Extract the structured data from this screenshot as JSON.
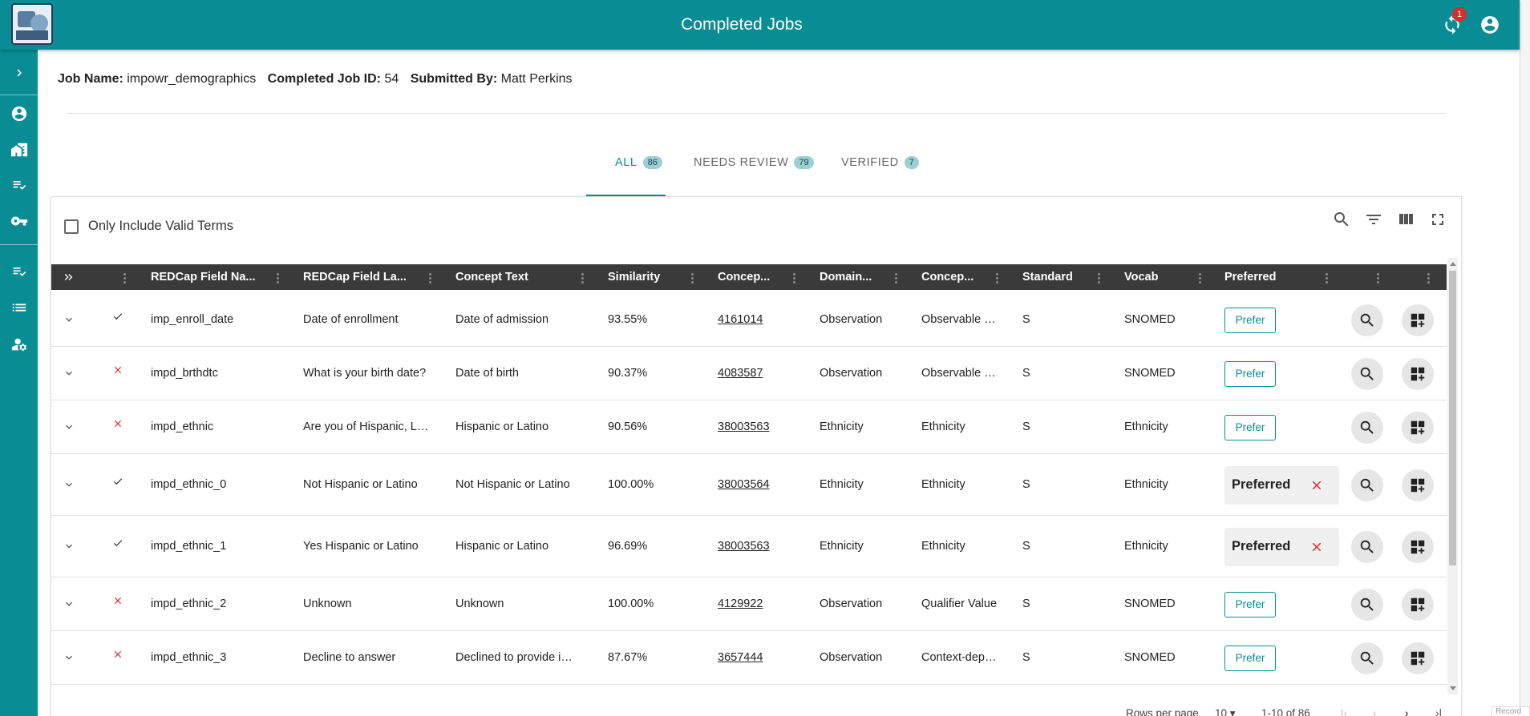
{
  "app": {
    "title": "Completed Jobs",
    "notification_count": "1",
    "accent": "#098c94"
  },
  "sidebar": {
    "icons": [
      "chevron-right-icon",
      "account-circle-icon",
      "home-work-icon",
      "playlist-check-icon",
      "key-icon",
      "playlist-check-icon",
      "list-icon",
      "manage-accounts-icon"
    ]
  },
  "job": {
    "name_label": "Job Name:",
    "name": "impowr_demographics",
    "id_label": "Completed Job ID:",
    "id": "54",
    "submitter_label": "Submitted By:",
    "submitter": "Matt Perkins"
  },
  "tabs": [
    {
      "label": "ALL",
      "count": "86"
    },
    {
      "label": "NEEDS REVIEW",
      "count": "79"
    },
    {
      "label": "VERIFIED",
      "count": "7"
    }
  ],
  "filter": {
    "valid_terms_label": "Only Include Valid Terms"
  },
  "toolbar_icons": [
    "search-icon",
    "filter-list-icon",
    "view-column-icon",
    "fullscreen-icon"
  ],
  "table": {
    "headers": [
      "REDCap Field Na...",
      "REDCap Field La...",
      "Concept Text",
      "Similarity",
      "Concep...",
      "Domain...",
      "Concep...",
      "Standard",
      "Vocab",
      "Preferred"
    ],
    "rows": [
      {
        "valid": "check",
        "field_name": "imp_enroll_date",
        "field_label": "Date of enrollment",
        "concept_text": "Date of admission",
        "similarity": "93.55%",
        "concept_id": "4161014",
        "domain": "Observation",
        "concept_class": "Observable En...",
        "standard": "S",
        "vocab": "SNOMED",
        "preferred": false
      },
      {
        "valid": "x",
        "field_name": "impd_brthdtc",
        "field_label": "What is your birth date?",
        "concept_text": "Date of birth",
        "similarity": "90.37%",
        "concept_id": "4083587",
        "domain": "Observation",
        "concept_class": "Observable En...",
        "standard": "S",
        "vocab": "SNOMED",
        "preferred": false
      },
      {
        "valid": "x",
        "field_name": "impd_ethnic",
        "field_label": "Are you of Hispanic, Lati...",
        "concept_text": "Hispanic or Latino",
        "similarity": "90.56%",
        "concept_id": "38003563",
        "domain": "Ethnicity",
        "concept_class": "Ethnicity",
        "standard": "S",
        "vocab": "Ethnicity",
        "preferred": false
      },
      {
        "valid": "check",
        "field_name": "impd_ethnic_0",
        "field_label": "Not Hispanic or Latino",
        "concept_text": "Not Hispanic or Latino",
        "similarity": "100.00%",
        "concept_id": "38003564",
        "domain": "Ethnicity",
        "concept_class": "Ethnicity",
        "standard": "S",
        "vocab": "Ethnicity",
        "preferred": true
      },
      {
        "valid": "check",
        "field_name": "impd_ethnic_1",
        "field_label": "Yes Hispanic or Latino",
        "concept_text": "Hispanic or Latino",
        "similarity": "96.69%",
        "concept_id": "38003563",
        "domain": "Ethnicity",
        "concept_class": "Ethnicity",
        "standard": "S",
        "vocab": "Ethnicity",
        "preferred": true
      },
      {
        "valid": "x",
        "field_name": "impd_ethnic_2",
        "field_label": "Unknown",
        "concept_text": "Unknown",
        "similarity": "100.00%",
        "concept_id": "4129922",
        "domain": "Observation",
        "concept_class": "Qualifier Value",
        "standard": "S",
        "vocab": "SNOMED",
        "preferred": false
      },
      {
        "valid": "x",
        "field_name": "impd_ethnic_3",
        "field_label": "Decline to answer",
        "concept_text": "Declined to provide infor...",
        "similarity": "87.67%",
        "concept_id": "3657444",
        "domain": "Observation",
        "concept_class": "Context-depen...",
        "standard": "S",
        "vocab": "SNOMED",
        "preferred": false
      }
    ],
    "prefer_label": "Prefer",
    "preferred_label": "Preferred"
  },
  "pagination": {
    "rows_per_page_label": "Rows per page",
    "rows_per_page": "10",
    "range": "1-10 of 86"
  },
  "record_tag": "Record"
}
